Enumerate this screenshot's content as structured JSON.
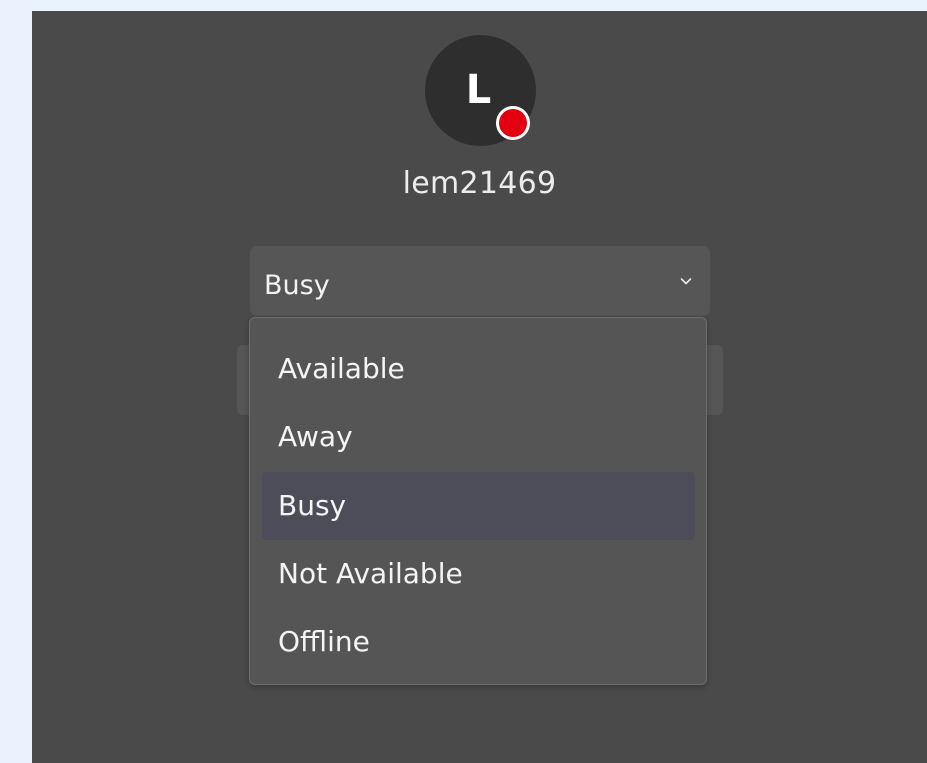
{
  "user": {
    "initial": "L",
    "username": "lem21469",
    "status_color": "#e3000f"
  },
  "status_select": {
    "value": "Busy",
    "icon": "chevron-down-icon"
  },
  "status_options": [
    {
      "label": "Available"
    },
    {
      "label": "Away"
    },
    {
      "label": "Busy",
      "selected": true
    },
    {
      "label": "Not Available"
    },
    {
      "label": "Offline"
    }
  ]
}
